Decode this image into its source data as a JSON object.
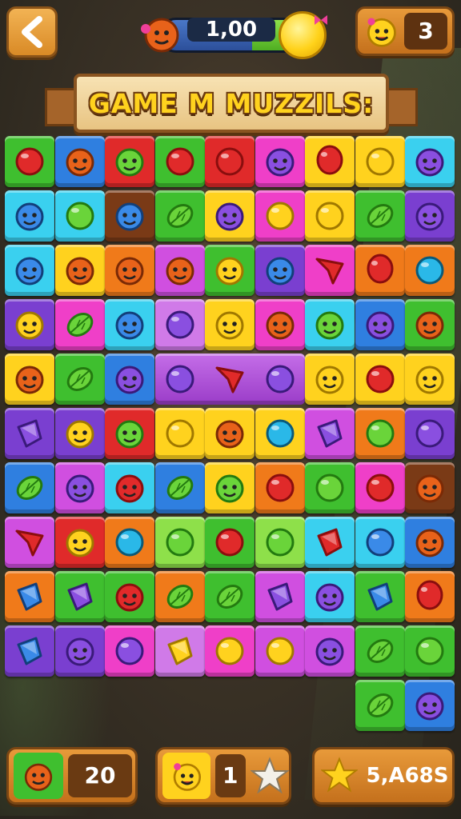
{
  "hud": {
    "progress_value": "1,00",
    "progress_fraction": 0.6,
    "lives": "3"
  },
  "banner": {
    "title": "GAME M MUZZILS:"
  },
  "colors": {
    "green": "#3fbf2f",
    "blue": "#2f7fe0",
    "red": "#e02a2a",
    "pink": "#ef3fc8",
    "yellow": "#ffd21e",
    "cyan": "#3ad0ef",
    "purple": "#7a3fd0",
    "orange": "#f07a1a",
    "brown": "#7a3a16",
    "lime": "#8ee04a",
    "magenta": "#d04fe0",
    "lavender": "#d07ae8"
  },
  "board": {
    "cols": 9,
    "rows": [
      [
        [
          "green",
          "red-ball"
        ],
        [
          "blue",
          "orange-critter"
        ],
        [
          "red",
          "green-critter"
        ],
        [
          "green",
          "red-ball"
        ],
        [
          "red",
          "red-ball"
        ],
        [
          "pink",
          "purple-critter"
        ],
        [
          "yellow",
          "red-balloon"
        ],
        [
          "yellow",
          "yellow-ball"
        ],
        [
          "cyan",
          "purple-critter"
        ]
      ],
      [
        [
          "cyan",
          "blue-critter"
        ],
        [
          "cyan",
          "green-ball"
        ],
        [
          "brown",
          "blue-critter"
        ],
        [
          "green",
          "green-leaf"
        ],
        [
          "yellow",
          "purple-critter"
        ],
        [
          "pink",
          "yellow-ball"
        ],
        [
          "yellow",
          "yellow-ball"
        ],
        [
          "green",
          "green-leaf"
        ],
        [
          "purple",
          "purple-critter"
        ]
      ],
      [
        [
          "cyan",
          "blue-critter"
        ],
        [
          "yellow",
          "orange-critter"
        ],
        [
          "orange",
          "orange-critter"
        ],
        [
          "magenta",
          "orange-critter"
        ],
        [
          "green",
          "yellow-critter"
        ],
        [
          "purple",
          "blue-critter"
        ],
        [
          "pink",
          "red-star"
        ],
        [
          "orange",
          "red-balloon"
        ],
        [
          "orange",
          "cyan-ball"
        ]
      ],
      [
        [
          "purple",
          "yellow-critter"
        ],
        [
          "pink",
          "green-leaf"
        ],
        [
          "cyan",
          "blue-critter"
        ],
        [
          "lavender",
          "purple-ball"
        ],
        [
          "yellow",
          "yellow-critter"
        ],
        [
          "pink",
          "orange-critter"
        ],
        [
          "cyan",
          "green-critter"
        ],
        [
          "blue",
          "purple-critter"
        ],
        [
          "green",
          "orange-critter"
        ]
      ],
      [
        [
          "yellow",
          "orange-critter"
        ],
        [
          "green",
          "green-leaf"
        ],
        [
          "blue",
          "purple-critter"
        ],
        [
          "merge",
          "purple-ball"
        ],
        [
          "merge",
          "red-star"
        ],
        [
          "merge",
          "purple-ball"
        ],
        [
          "yellow",
          "yellow-critter"
        ],
        [
          "yellow",
          "red-ball"
        ],
        [
          "yellow",
          "yellow-critter"
        ]
      ],
      [
        [
          "purple",
          "purple-gem"
        ],
        [
          "purple",
          "yellow-critter"
        ],
        [
          "red",
          "green-critter"
        ],
        [
          "yellow",
          "yellow-ball"
        ],
        [
          "yellow",
          "orange-critter"
        ],
        [
          "yellow",
          "cyan-ball"
        ],
        [
          "magenta",
          "purple-gem"
        ],
        [
          "orange",
          "green-ball"
        ],
        [
          "purple",
          "purple-ball"
        ]
      ],
      [
        [
          "blue",
          "green-leaf"
        ],
        [
          "magenta",
          "purple-critter"
        ],
        [
          "cyan",
          "red-critter"
        ],
        [
          "blue",
          "green-leaf"
        ],
        [
          "yellow",
          "green-critter"
        ],
        [
          "orange",
          "red-ball"
        ],
        [
          "green",
          "green-ball"
        ],
        [
          "pink",
          "red-ball"
        ],
        [
          "brown",
          "orange-critter"
        ]
      ],
      [
        [
          "magenta",
          "red-star"
        ],
        [
          "red",
          "yellow-critter"
        ],
        [
          "orange",
          "cyan-ball"
        ],
        [
          "lime",
          "green-ball"
        ],
        [
          "green",
          "red-ball"
        ],
        [
          "lime",
          "green-ball"
        ],
        [
          "cyan",
          "red-gem"
        ],
        [
          "cyan",
          "blue-ball"
        ],
        [
          "blue",
          "orange-critter"
        ]
      ],
      [
        [
          "orange",
          "blue-gem"
        ],
        [
          "green",
          "purple-gem"
        ],
        [
          "green",
          "red-critter"
        ],
        [
          "orange",
          "green-leaf"
        ],
        [
          "green",
          "green-leaf"
        ],
        [
          "magenta",
          "purple-gem"
        ],
        [
          "cyan",
          "purple-critter"
        ],
        [
          "green",
          "blue-gem"
        ],
        [
          "orange",
          "red-balloon"
        ]
      ],
      [
        [
          "purple",
          "blue-gem"
        ],
        [
          "purple",
          "purple-critter"
        ],
        [
          "pink",
          "purple-ball"
        ],
        [
          "lavender",
          "yellow-gem"
        ],
        [
          "pink",
          "yellow-ball"
        ],
        [
          "magenta",
          "yellow-ball"
        ],
        [
          "magenta",
          "purple-critter"
        ],
        [
          "green",
          "green-leaf"
        ],
        [
          "green",
          "green-ball"
        ]
      ],
      [
        null,
        null,
        null,
        null,
        null,
        null,
        null,
        [
          "green",
          "green-leaf"
        ],
        [
          "blue",
          "purple-critter"
        ]
      ]
    ]
  },
  "bottom": {
    "moves": "20",
    "targets": "1",
    "score": "5,A68S"
  }
}
